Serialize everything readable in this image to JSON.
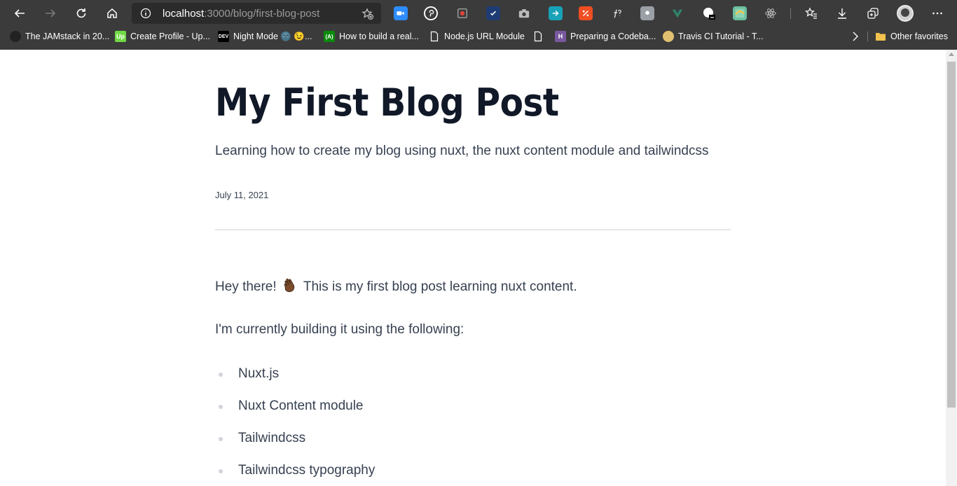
{
  "browser": {
    "url_host": "localhost",
    "url_path": ":3000/blog/first-blog-post",
    "bookmarks": [
      {
        "label": "The JAMstack in 20...",
        "icon": "circle-icon",
        "color": "#222222"
      },
      {
        "label": "Create Profile - Up...",
        "icon": "upwork-icon",
        "color": "#6fda44"
      },
      {
        "label": "Night Mode 🌚 😉...",
        "icon": "dev-icon",
        "color": "#000000"
      },
      {
        "label": "How to build a real...",
        "icon": "freecodecamp-icon",
        "color": "#0a8a0a"
      },
      {
        "label": "Node.js URL Module",
        "icon": "page-icon",
        "color": "#ffffff"
      },
      {
        "label": "",
        "icon": "page-icon",
        "color": "#ffffff"
      },
      {
        "label": "Preparing a Codeba...",
        "icon": "heroku-icon",
        "color": "#79589f"
      },
      {
        "label": "Travis CI Tutorial - T...",
        "icon": "travis-icon",
        "color": "#e0c070"
      }
    ],
    "other_favorites": "Other favorites"
  },
  "post": {
    "title": "My First Blog Post",
    "description": "Learning how to create my blog using nuxt, the nuxt content module and tailwindcss",
    "date": "July 11, 2021",
    "intro_before": "Hey there!",
    "intro_after": "This is my first blog post learning nuxt content.",
    "building_intro": "I'm currently building it using the following:",
    "tools": [
      "Nuxt.js",
      "Nuxt Content module",
      "Tailwindcss",
      "Tailwindcss typography"
    ]
  }
}
